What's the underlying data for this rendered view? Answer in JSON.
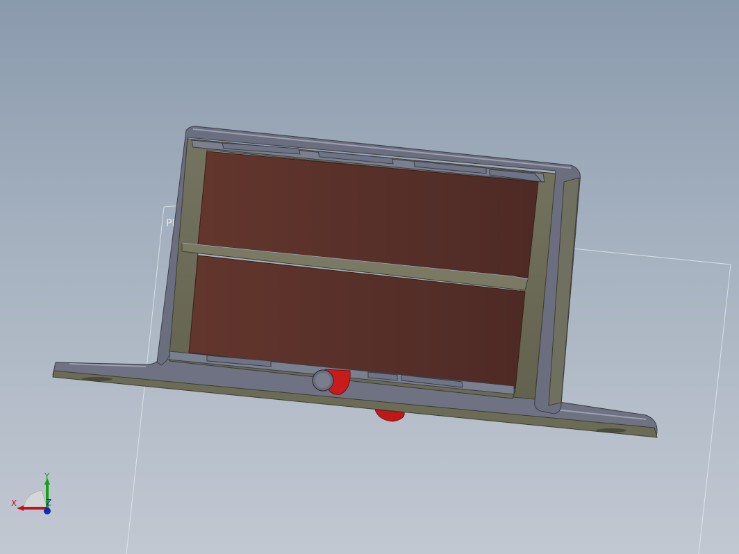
{
  "viewport": {
    "plane_label": "Pl",
    "background_top": "#8a9aad",
    "background_bottom": "#c2c8d2"
  },
  "colors": {
    "bracket_face": "#6e6e58",
    "bracket_edge": "#6c7080",
    "coil": "#5b322a",
    "screw": "#c01818",
    "plane_line": "#dfe4ea"
  },
  "triad": {
    "x_label": "X",
    "y_label": "Y",
    "z_label": "Z",
    "x_color": "#c0141e",
    "y_color": "#16a016",
    "z_color": "#1428b4"
  }
}
